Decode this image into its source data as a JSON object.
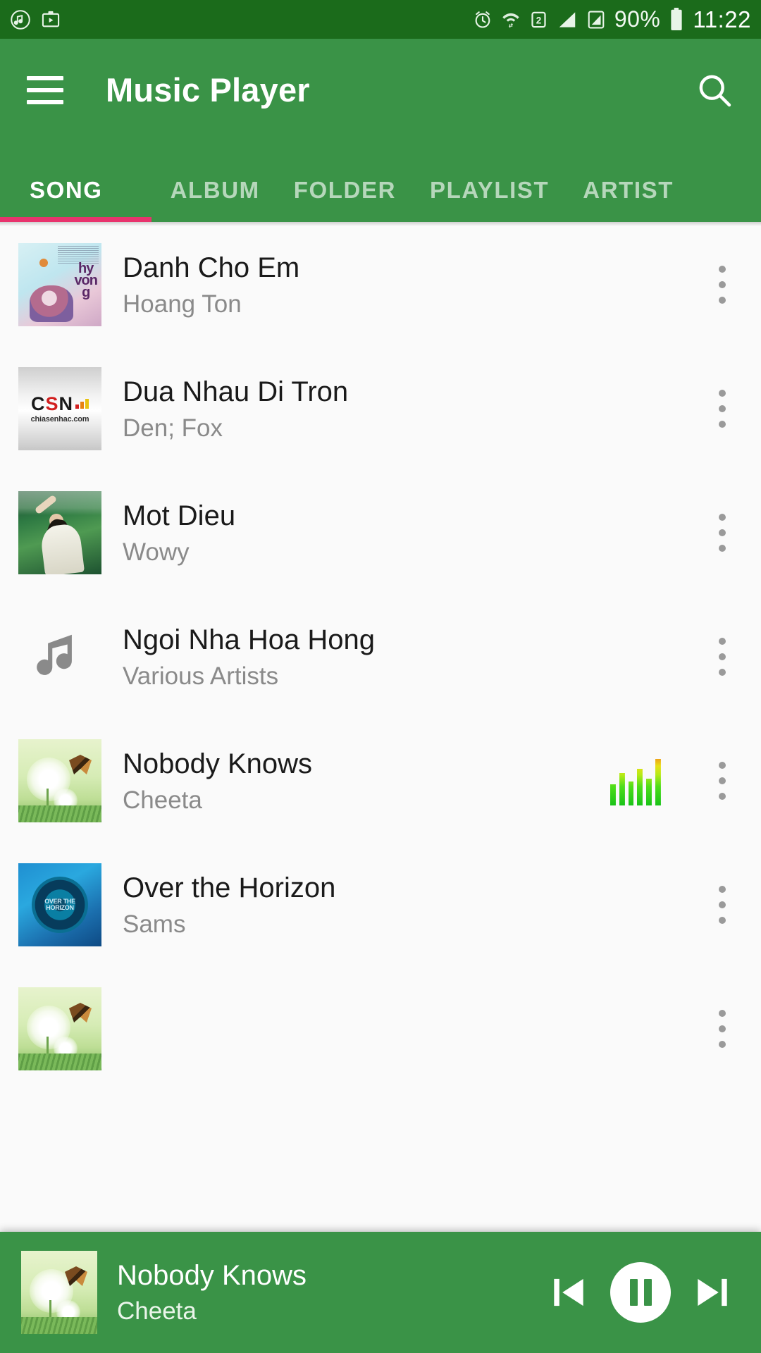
{
  "theme": {
    "status_bar_bg": "#1b6b1b",
    "app_bar_bg": "#3a9347",
    "accent_pink": "#e8336d",
    "list_bg": "#fafafa"
  },
  "status_bar": {
    "icons_left": [
      "music-note-app-icon",
      "screen-recorder-icon"
    ],
    "icons_right": [
      "alarm-icon",
      "wifi-icon",
      "sim2-icon",
      "signal-bars-icon",
      "signal-bars-2-icon"
    ],
    "battery_percent": "90%",
    "battery_icon": "battery-icon",
    "time": "11:22"
  },
  "app_bar": {
    "menu_icon": "hamburger-menu-icon",
    "title": "Music Player",
    "search_icon": "search-icon"
  },
  "tabs": {
    "active_index": 0,
    "items": [
      {
        "label": "SONG"
      },
      {
        "label": "ALBUM"
      },
      {
        "label": "FOLDER"
      },
      {
        "label": "PLAYLIST"
      },
      {
        "label": "ARTIST"
      }
    ]
  },
  "songs": [
    {
      "title": "Danh Cho Em",
      "artist": "Hoang Ton",
      "art": "hyvong",
      "playing": false
    },
    {
      "title": "Dua Nhau Di Tron",
      "artist": "Den; Fox",
      "art": "csn",
      "playing": false
    },
    {
      "title": "Mot Dieu",
      "artist": "Wowy",
      "art": "wowy",
      "playing": false
    },
    {
      "title": "Ngoi Nha Hoa Hong",
      "artist": "Various Artists",
      "art": "note",
      "playing": false
    },
    {
      "title": "Nobody Knows",
      "artist": "Cheeta",
      "art": "dandelion",
      "playing": true
    },
    {
      "title": "Over the Horizon",
      "artist": "Sams",
      "art": "horizon",
      "playing": false
    },
    {
      "title": "",
      "artist": "",
      "art": "dandelion",
      "playing": false
    }
  ],
  "csn_logo": {
    "c": "C",
    "s": "S",
    "n": "N",
    "subtitle": "chiasenhac.com"
  },
  "horizon_art_text": "OVER THE HORIZON",
  "row_menu_icon": "more-vertical-icon",
  "equalizer_icon": "now-playing-equalizer-icon",
  "player": {
    "title": "Nobody Knows",
    "artist": "Cheeta",
    "art": "dandelion",
    "prev_icon": "skip-previous-icon",
    "play_pause_icon": "pause-icon",
    "next_icon": "skip-next-icon",
    "is_playing": true
  }
}
